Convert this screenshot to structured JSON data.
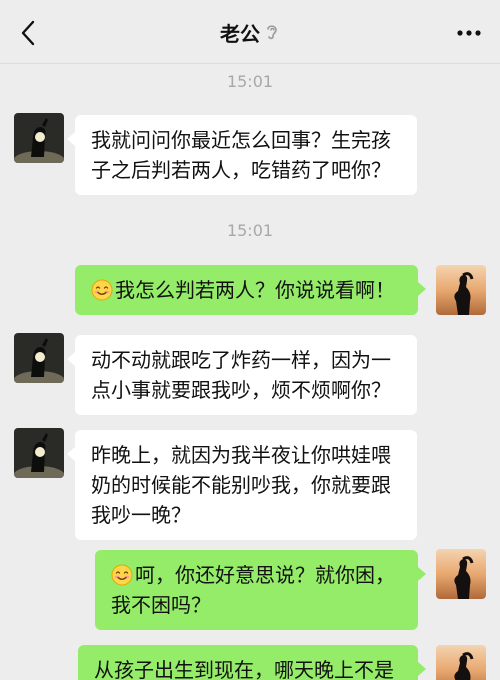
{
  "header": {
    "title": "老公",
    "back_icon": "chevron-left-icon",
    "ear_icon": "ear-icon",
    "more_icon": "more-dots-icon"
  },
  "timestamps": [
    "15:01",
    "15:01"
  ],
  "messages": [
    {
      "side": "left",
      "avatar": "husband-avatar",
      "text": "我就问问你最近怎么回事？生完孩子之后判若两人，吃错药了吧你？"
    },
    {
      "side": "right",
      "avatar": "wife-avatar",
      "emoji": "smile-emoji",
      "text": "我怎么判若两人？你说说看啊！"
    },
    {
      "side": "left",
      "avatar": "husband-avatar",
      "text": "动不动就跟吃了炸药一样，因为一点小事就要跟我吵，烦不烦啊你？"
    },
    {
      "side": "left",
      "avatar": "husband-avatar",
      "text": "昨晚上，就因为我半夜让你哄娃喂奶的时候能不能别吵我，你就要跟我吵一晚？"
    },
    {
      "side": "right",
      "avatar": "wife-avatar",
      "emoji": "smile-emoji",
      "text": "呵，你还好意思说？就你困，我不困吗？"
    },
    {
      "side": "right",
      "avatar": "wife-avatar",
      "text": "从孩子出生到现在，哪天晚上不是"
    }
  ],
  "colors": {
    "background": "#ededed",
    "left_bubble": "#ffffff",
    "right_bubble": "#95ec69",
    "timestamp": "#a8a8a8"
  }
}
